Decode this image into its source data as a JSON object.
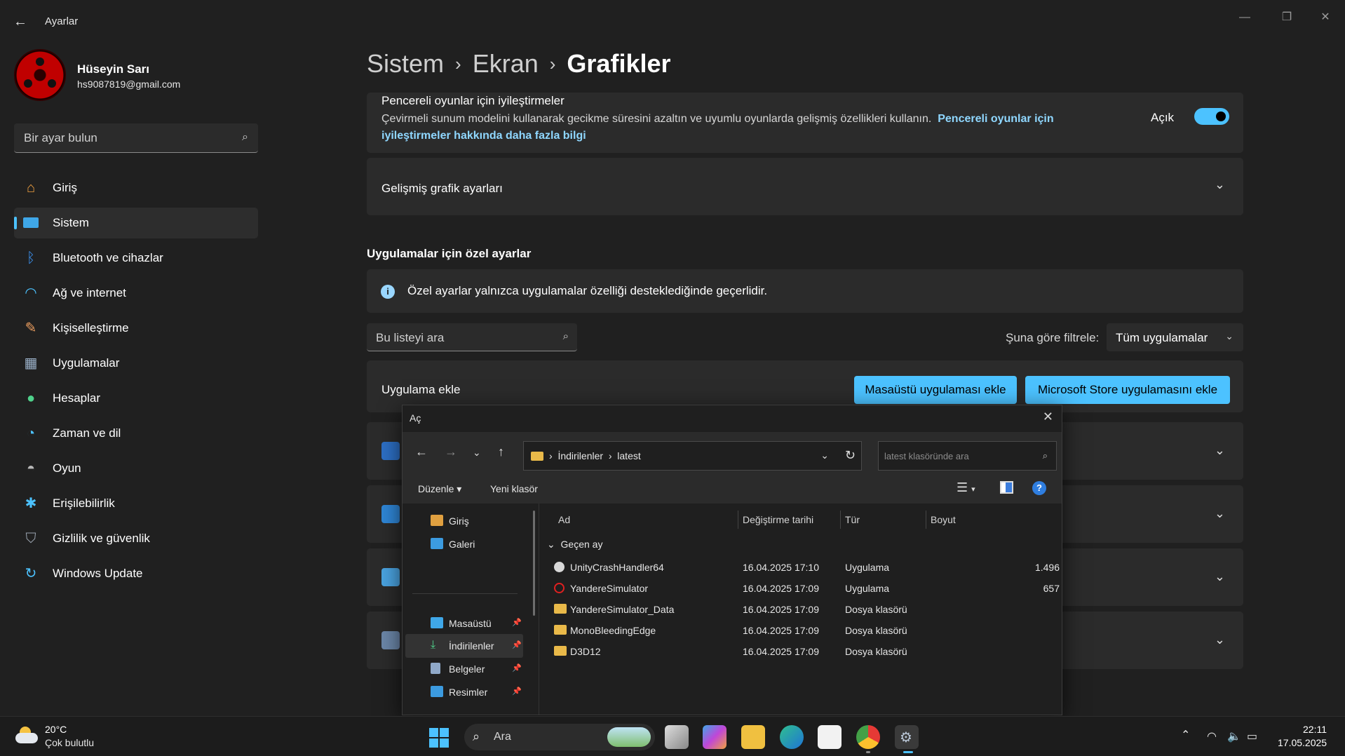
{
  "window": {
    "app_title": "Ayarlar"
  },
  "user": {
    "name": "Hüseyin Sarı",
    "email": "hs9087819@gmail.com"
  },
  "search": {
    "placeholder": "Bir ayar bulun"
  },
  "nav": [
    {
      "label": "Giriş",
      "icon": "home-icon",
      "active": false
    },
    {
      "label": "Sistem",
      "icon": "system-icon",
      "active": true
    },
    {
      "label": "Bluetooth ve cihazlar",
      "icon": "bluetooth-icon",
      "active": false
    },
    {
      "label": "Ağ ve internet",
      "icon": "wifi-icon",
      "active": false
    },
    {
      "label": "Kişiselleştirme",
      "icon": "brush-icon",
      "active": false
    },
    {
      "label": "Uygulamalar",
      "icon": "apps-icon",
      "active": false
    },
    {
      "label": "Hesaplar",
      "icon": "account-icon",
      "active": false
    },
    {
      "label": "Zaman ve dil",
      "icon": "clock-globe-icon",
      "active": false
    },
    {
      "label": "Oyun",
      "icon": "gamepad-icon",
      "active": false
    },
    {
      "label": "Erişilebilirlik",
      "icon": "accessibility-icon",
      "active": false
    },
    {
      "label": "Gizlilik ve güvenlik",
      "icon": "shield-icon",
      "active": false
    },
    {
      "label": "Windows Update",
      "icon": "update-icon",
      "active": false
    }
  ],
  "breadcrumb": {
    "level1": "Sistem",
    "level2": "Ekran",
    "current": "Grafikler"
  },
  "windowed_games": {
    "title": "Pencereli oyunlar için iyileştirmeler",
    "description": "Çevirmeli sunum modelini kullanarak gecikme süresini azaltın ve uyumlu oyunlarda gelişmiş özellikleri kullanın.",
    "link": "Pencereli oyunlar için iyileştirmeler hakkında daha fazla bilgi",
    "toggle_label": "Açık",
    "toggle_on": true
  },
  "advanced": {
    "title": "Gelişmiş grafik ayarları"
  },
  "custom": {
    "section_title": "Uygulamalar için özel ayarlar",
    "info": "Özel ayarlar yalnızca uygulamalar özelliği desteklediğinde geçerlidir.",
    "list_search_placeholder": "Bu listeyi ara",
    "filter_label": "Şuna göre filtrele:",
    "filter_value": "Tüm uygulamalar",
    "add_app_label": "Uygulama ekle",
    "add_desktop_button": "Masaüstü uygulaması ekle",
    "add_store_button": "Microsoft Store uygulamasını ekle"
  },
  "dialog": {
    "title": "Aç",
    "path": [
      "İndirilenler",
      "latest"
    ],
    "search_placeholder": "latest klasöründe ara",
    "organize_label": "Düzenle",
    "new_folder_label": "Yeni klasör",
    "help_label": "?",
    "tree": [
      {
        "label": "Giriş",
        "icon": "home-icon",
        "pinned": false,
        "selected": false
      },
      {
        "label": "Galeri",
        "icon": "gallery-icon",
        "pinned": false,
        "selected": false
      },
      {
        "label": "Masaüstü",
        "icon": "desktop-icon",
        "pinned": true,
        "selected": false
      },
      {
        "label": "İndirilenler",
        "icon": "download-icon",
        "pinned": true,
        "selected": true
      },
      {
        "label": "Belgeler",
        "icon": "documents-icon",
        "pinned": true,
        "selected": false
      },
      {
        "label": "Resimler",
        "icon": "pictures-icon",
        "pinned": true,
        "selected": false
      }
    ],
    "columns": [
      "Ad",
      "Değiştirme tarihi",
      "Tür",
      "Boyut"
    ],
    "group_label": "Geçen ay",
    "files": [
      {
        "name": "UnityCrashHandler64",
        "date": "16.04.2025 17:10",
        "type": "Uygulama",
        "size": "1.496",
        "icon": "unity-app-icon"
      },
      {
        "name": "YandereSimulator",
        "date": "16.04.2025 17:09",
        "type": "Uygulama",
        "size": "657",
        "icon": "yandere-app-icon"
      },
      {
        "name": "YandereSimulator_Data",
        "date": "16.04.2025 17:09",
        "type": "Dosya klasörü",
        "size": "",
        "icon": "folder-icon"
      },
      {
        "name": "MonoBleedingEdge",
        "date": "16.04.2025 17:09",
        "type": "Dosya klasörü",
        "size": "",
        "icon": "folder-icon"
      },
      {
        "name": "D3D12",
        "date": "16.04.2025 17:09",
        "type": "Dosya klasörü",
        "size": "",
        "icon": "folder-icon"
      }
    ]
  },
  "taskbar": {
    "weather_temp": "20°C",
    "weather_desc": "Çok bulutlu",
    "search_placeholder": "Ara",
    "time": "22:11",
    "date": "17.05.2025"
  },
  "colors": {
    "accent": "#4cc2ff",
    "background": "#202020",
    "card": "#2b2b2b",
    "link": "#8fd7ff"
  }
}
